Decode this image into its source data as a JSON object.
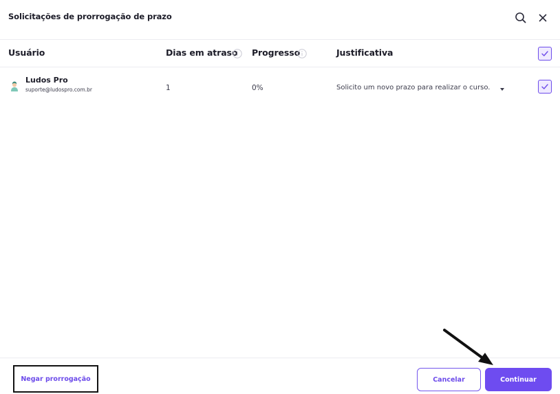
{
  "dialog": {
    "title": "Solicitações de prorrogação de prazo",
    "search_icon": "search-icon",
    "close_icon": "close-icon"
  },
  "table": {
    "columns": {
      "user": "Usuário",
      "days_late": "Dias em atraso",
      "progress": "Progresso",
      "justification": "Justificativa"
    },
    "select_all_checked": true,
    "rows": [
      {
        "name": "Ludos Pro",
        "email": "suporte@ludospro.com.br",
        "days_late": "1",
        "progress": "0%",
        "justification": "Solicito um novo prazo para realizar o curso.",
        "checked": true
      }
    ]
  },
  "footer": {
    "deny_label": "Negar prorrogação",
    "cancel_label": "Cancelar",
    "continue_label": "Continuar"
  },
  "colors": {
    "accent": "#6e4cf0",
    "annotation": "#111111"
  }
}
